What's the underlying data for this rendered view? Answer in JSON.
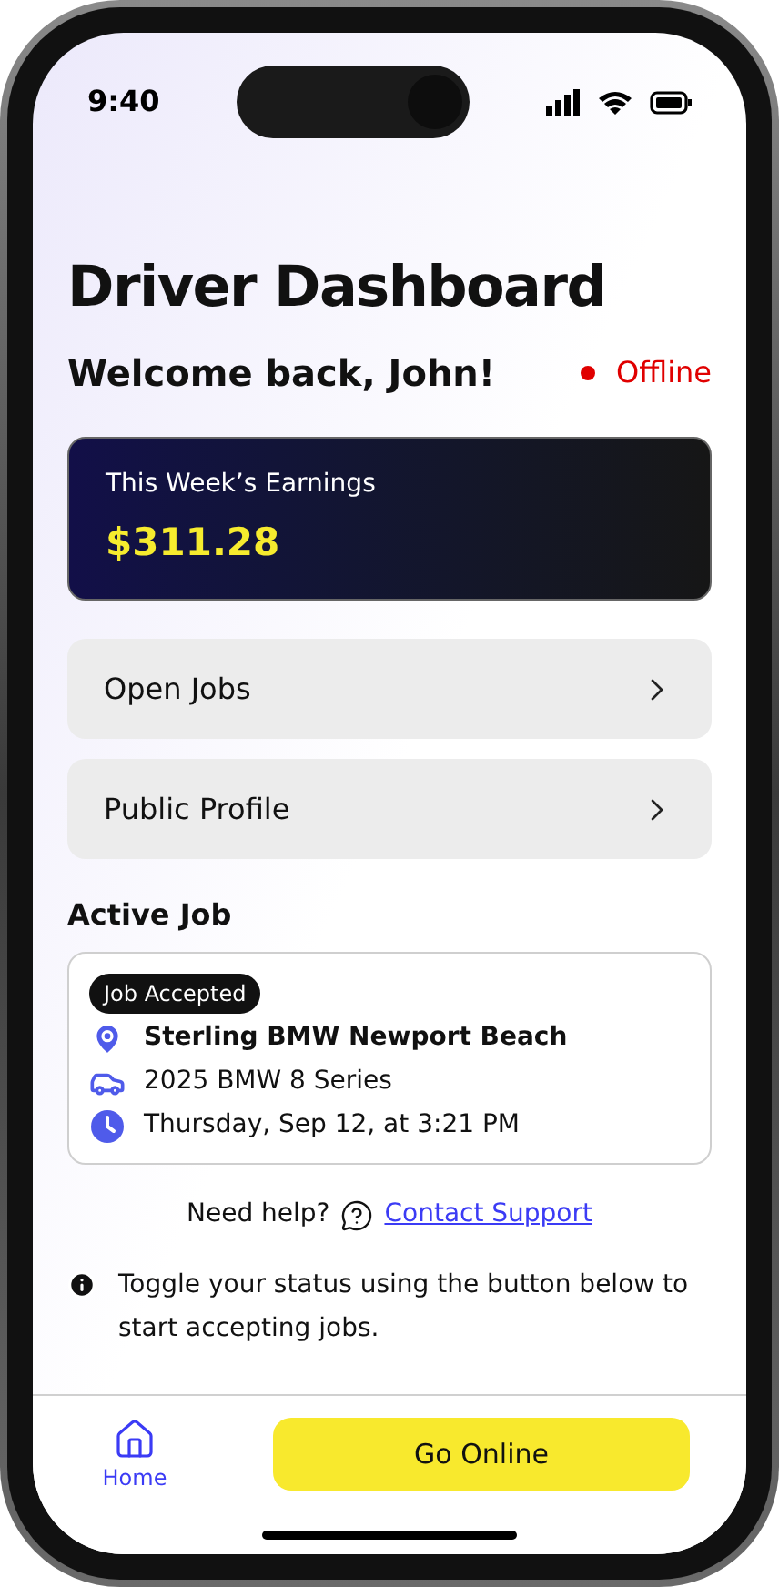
{
  "status_bar": {
    "time": "9:40"
  },
  "title": "Driver Dashboard",
  "greeting": "Welcome back, John!",
  "driver_status": {
    "label": "Offline",
    "online": false
  },
  "earnings": {
    "label": "This Week’s Earnings",
    "amount": "$311.28"
  },
  "menu": [
    {
      "label": "Open Jobs"
    },
    {
      "label": "Public Profile"
    }
  ],
  "active_job": {
    "heading": "Active Job",
    "badge": "Job Accepted",
    "details": [
      {
        "kind": "location",
        "text": "Sterling BMW Newport Beach"
      },
      {
        "kind": "vehicle",
        "text": "2025 BMW 8 Series"
      },
      {
        "kind": "time",
        "text": "Thursday, Sep 12, at 3:21 PM"
      }
    ]
  },
  "help": {
    "text": "Need help?",
    "link": "Contact Support"
  },
  "info": "Toggle your status using the button below to start accepting jobs.",
  "bottom_nav": {
    "items": [
      {
        "label": "Home",
        "selected": true
      }
    ],
    "action": "Go Online"
  }
}
